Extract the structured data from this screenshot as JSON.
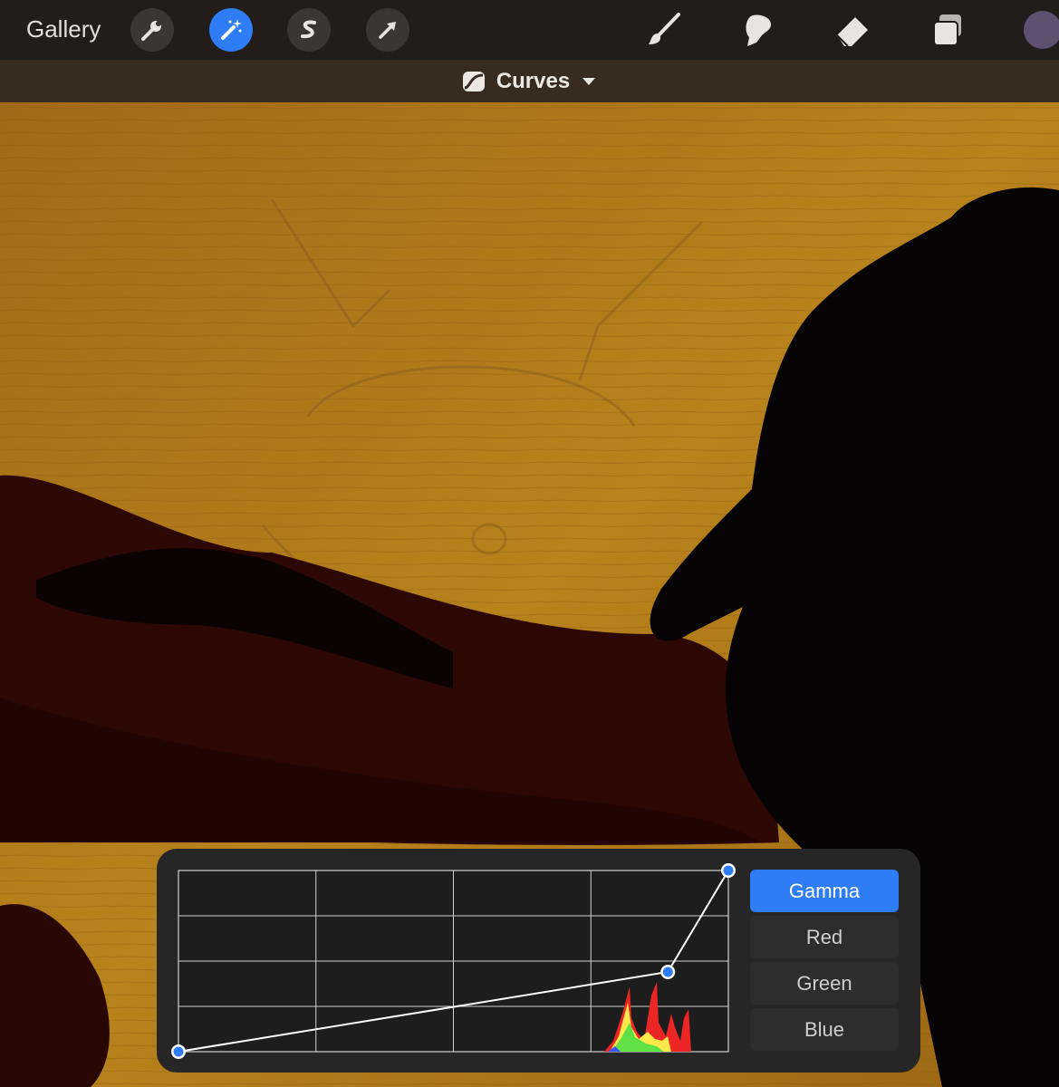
{
  "toolbar": {
    "gallery_label": "Gallery",
    "tools": [
      "wrench-icon",
      "magic-wand-icon",
      "selection-icon",
      "arrow-icon"
    ],
    "right_tools": [
      "brush-icon",
      "smudge-icon",
      "eraser-icon",
      "layers-icon"
    ],
    "active_tool": "magic-wand-icon",
    "current_color": "#5f5070",
    "accent_color": "#2f7df6"
  },
  "adjustment": {
    "title": "Curves",
    "icon": "curves-icon"
  },
  "curves_panel": {
    "channels": [
      "Gamma",
      "Red",
      "Green",
      "Blue"
    ],
    "active_channel": "Gamma",
    "curve_points": [
      {
        "input": 0.0,
        "output": 0.0
      },
      {
        "input": 0.89,
        "output": 0.44
      },
      {
        "input": 1.0,
        "output": 1.0
      }
    ]
  }
}
